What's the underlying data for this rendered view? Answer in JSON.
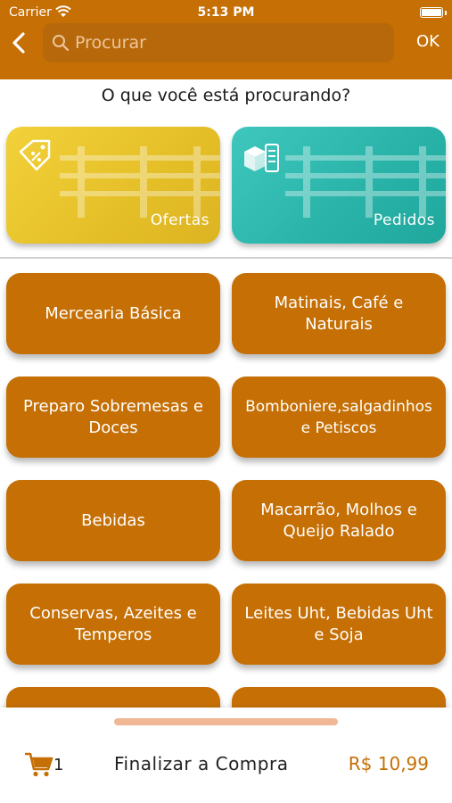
{
  "status_bar": {
    "carrier": "Carrier",
    "time": "5:13 PM"
  },
  "header": {
    "search_placeholder": "Procurar",
    "ok_label": "OK"
  },
  "question": "O que você está procurando?",
  "promos": [
    {
      "label": "Ofertas",
      "icon": "discount-tag-icon"
    },
    {
      "label": "Pedidos",
      "icon": "box-checklist-icon"
    }
  ],
  "categories": [
    "Mercearia Básica",
    "Matinais, Café e\nNaturais",
    "Preparo Sobremesas e\nDoces",
    "Bomboniere,salgadinhos\ne Petiscos",
    "Bebidas",
    "Macarrão, Molhos e\nQueijo Ralado",
    "Conservas, Azeites e\nTemperos",
    "Leites Uht, Bebidas Uht\ne Soja",
    "",
    ""
  ],
  "footer": {
    "cart_count": "1",
    "checkout_label": "Finalizar a Compra",
    "total": "R$ 10,99"
  },
  "colors": {
    "brand": "#c56f04",
    "offers": "#e5bf27",
    "orders": "#29b3a8"
  }
}
